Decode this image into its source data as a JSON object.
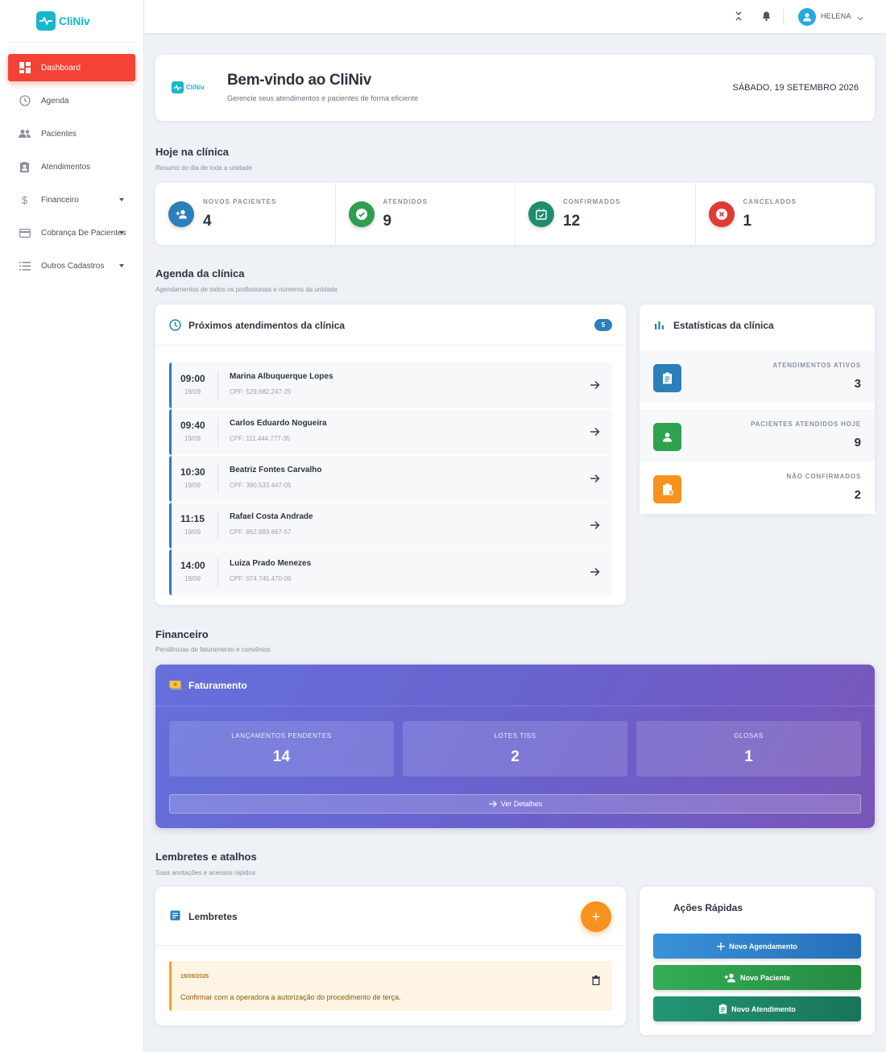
{
  "brand": {
    "name": "CliNiv"
  },
  "sidebar": {
    "items": [
      {
        "label": "Dashboard",
        "icon": "dashboard-icon",
        "active": true
      },
      {
        "label": "Agenda",
        "icon": "clock-icon"
      },
      {
        "label": "Pacientes",
        "icon": "people-icon"
      },
      {
        "label": "Atendimentos",
        "icon": "clipboard-user-icon"
      },
      {
        "label": "Financeiro",
        "icon": "dollar-icon",
        "expandable": true
      },
      {
        "label": "Cobrança De Pacientes",
        "icon": "credit-card-icon",
        "expandable": true
      },
      {
        "label": "Outros Cadastros",
        "icon": "list-icon",
        "expandable": true
      }
    ]
  },
  "topbar": {
    "user_name": "HELENA"
  },
  "welcome": {
    "logo_text": "CliNiv",
    "title": "Bem-vindo ao CliNiv",
    "subtitle": "Gerencie seus atendimentos e pacientes de forma eficiente",
    "date": "SÁBADO, 19 SETEMBRO 2026"
  },
  "today": {
    "title": "Hoje na clínica",
    "subtitle": "Resumo do dia de toda a unidade",
    "stats": [
      {
        "label": "NOVOS PACIENTES",
        "value": "4",
        "color": "#2c7fb8"
      },
      {
        "label": "ATENDIDOS",
        "value": "9",
        "color": "#2e9e4f"
      },
      {
        "label": "CONFIRMADOS",
        "value": "12",
        "color": "#1e8c6e"
      },
      {
        "label": "CANCELADOS",
        "value": "1",
        "color": "#e03a35"
      }
    ]
  },
  "agenda_section": {
    "title": "Agenda da clínica",
    "subtitle": "Agendamentos de todos os profissionais e números da unidade"
  },
  "agenda": {
    "title": "Próximos atendimentos da clínica",
    "count": "5",
    "appointments": [
      {
        "time": "09:00",
        "date": "19/09",
        "name": "Marina Albuquerque Lopes",
        "cpf": "CPF: 529.982.247-25"
      },
      {
        "time": "09:40",
        "date": "19/09",
        "name": "Carlos Eduardo Nogueira",
        "cpf": "CPF: 111.444.777-35"
      },
      {
        "time": "10:30",
        "date": "19/09",
        "name": "Beatriz Fontes Carvalho",
        "cpf": "CPF: 390.533.447-05"
      },
      {
        "time": "11:15",
        "date": "19/09",
        "name": "Rafael Costa Andrade",
        "cpf": "CPF: 862.883.667-57"
      },
      {
        "time": "14:00",
        "date": "19/09",
        "name": "Luiza Prado Menezes",
        "cpf": "CPF: 074.745.470-06"
      }
    ]
  },
  "estatisticas": {
    "title": "Estatísticas da clínica",
    "rows": [
      {
        "label": "ATENDIMENTOS ATIVOS",
        "value": "3",
        "color": "#2c7fb8"
      },
      {
        "label": "PACIENTES ATENDIDOS HOJE",
        "value": "9",
        "color": "#2e9e4f"
      },
      {
        "label": "NÃO CONFIRMADOS",
        "value": "2",
        "color": "#f6931e"
      }
    ]
  },
  "financeiro_section": {
    "title": "Financeiro",
    "subtitle": "Pendências de faturamento e convênios"
  },
  "faturamento": {
    "title": "Faturamento",
    "boxes": [
      {
        "label": "LANÇAMENTOS PENDENTES",
        "value": "14"
      },
      {
        "label": "LOTES TISS",
        "value": "2"
      },
      {
        "label": "GLOSAS",
        "value": "1"
      }
    ],
    "details_label": "Ver Detalhes"
  },
  "lembretes_section": {
    "title": "Lembretes e atalhos",
    "subtitle": "Suas anotações e acessos rápidos"
  },
  "lembretes": {
    "title": "Lembretes",
    "add_label": "+",
    "notes": [
      {
        "date": "19/09/2026",
        "text": "Confirmar com a operadora a autorização do procedimento de terça."
      }
    ]
  },
  "acoes": {
    "title": "Ações Rápidas",
    "buttons": [
      {
        "label": "Novo Agendamento",
        "color": "#2c86d0"
      },
      {
        "label": "Novo Paciente",
        "color": "#2ea24f"
      },
      {
        "label": "Novo Atendimento",
        "color": "#1e8c6e"
      }
    ]
  }
}
